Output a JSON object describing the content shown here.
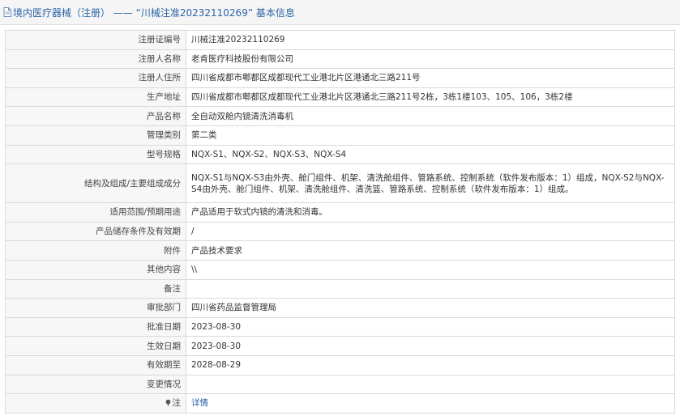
{
  "header": {
    "title": "境内医疗器械（注册） —— “川械注准20232110269” 基本信息"
  },
  "rows": [
    {
      "label": "注册证编号",
      "value": "川械注准20232110269"
    },
    {
      "label": "注册人名称",
      "value": "老肯医疗科技股份有限公司"
    },
    {
      "label": "注册人住所",
      "value": "四川省成都市郫都区成都现代工业港北片区港通北三路211号"
    },
    {
      "label": "生产地址",
      "value": "四川省成都市郫都区成都现代工业港北片区港通北三路211号2栋，3栋1楼103、105、106，3栋2楼"
    },
    {
      "label": "产品名称",
      "value": "全自动双舱内镜清洗消毒机"
    },
    {
      "label": "管理类别",
      "value": "第二类"
    },
    {
      "label": "型号规格",
      "value": "NQX-S1、NQX-S2、NQX-S3、NQX-S4"
    },
    {
      "label": "结构及组成/主要组成成分",
      "value": "NQX-S1与NQX-S3由外壳、舱门组件、机架、清洗舱组件、管路系统、控制系统（软件发布版本：1）组成，NQX-S2与NQX-S4由外壳、舱门组件、机架、清洗舱组件、清洗篮、管路系统、控制系统（软件发布版本：1）组成。"
    },
    {
      "label": "适用范围/预期用途",
      "value": "产品适用于软式内镜的清洗和消毒。"
    },
    {
      "label": "产品储存条件及有效期",
      "value": "/"
    },
    {
      "label": "附件",
      "value": "产品技术要求"
    },
    {
      "label": "其他内容",
      "value": "\\\\"
    },
    {
      "label": "备注",
      "value": ""
    },
    {
      "label": "审批部门",
      "value": "四川省药品监督管理局"
    },
    {
      "label": "批准日期",
      "value": "2023-08-30"
    },
    {
      "label": "生效日期",
      "value": "2023-08-30"
    },
    {
      "label": "有效期至",
      "value": "2028-08-29"
    },
    {
      "label": "变更情况",
      "value": ""
    }
  ],
  "note_row": {
    "label": "注",
    "link_text": "详情"
  }
}
